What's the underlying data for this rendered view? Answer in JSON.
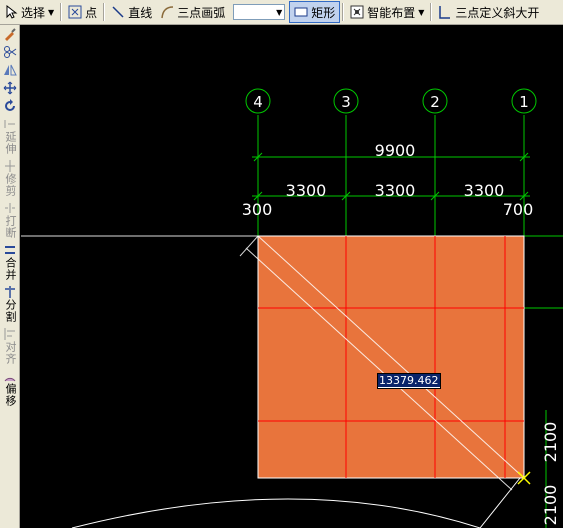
{
  "toolbar": {
    "select_label": "选择",
    "point_label": "点",
    "line_label": "直线",
    "arc_label": "三点画弧",
    "combo_value": "",
    "rect_label": "矩形",
    "smart_label": "智能布置",
    "slope_label": "三点定义斜大开"
  },
  "sidebar": {
    "extend": "延伸",
    "trim": "修剪",
    "break": "打断",
    "merge": "合并",
    "split": "分割",
    "align": "对齐",
    "offset": "偏移"
  },
  "axes": [
    "4",
    "3",
    "2",
    "1"
  ],
  "dims": {
    "total": "9900",
    "spans": [
      "3300",
      "3300",
      "3300"
    ],
    "left_offset": "300",
    "right_offset": "700",
    "right_a": "2100",
    "right_b": "2100"
  },
  "input_value": "13379.462",
  "colors": {
    "slab": "#e8743c",
    "axis": "#00c800",
    "grid": "#ff0000",
    "dim_text": "#ffffff"
  }
}
